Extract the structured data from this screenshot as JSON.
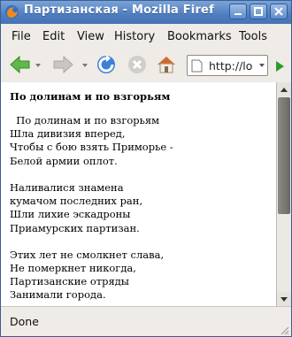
{
  "window": {
    "title": "Партизанская - Mozilla Firef"
  },
  "menu": [
    {
      "label": "File"
    },
    {
      "label": "Edit"
    },
    {
      "label": "View"
    },
    {
      "label": "History"
    },
    {
      "label": "Bookmarks"
    },
    {
      "label": "Tools"
    }
  ],
  "navbar": {
    "url": "http://lo"
  },
  "page": {
    "title": "По долинам и по взгорьям",
    "stanzas": [
      [
        "  По долинам и по взгорьям",
        "Шла дивизия вперед,",
        "Чтобы с бою взять Приморье -",
        "Белой армии оплот."
      ],
      [
        "Наливалися знамена",
        "кумачом последних ран,",
        "Шли лихие эскадроны",
        "Приамурских партизан."
      ],
      [
        "Этих лет не смолкнет слава,",
        "Не померкнет никогда,",
        "Партизанские отряды",
        "Занимали города."
      ]
    ]
  },
  "status": {
    "text": "Done"
  },
  "colors": {
    "titlebar": "#4f7dbf",
    "back_arrow": "#4aa33b",
    "reload": "#3b82d6",
    "go": "#2e9a2e"
  },
  "icons": [
    "firefox-icon",
    "minimize-icon",
    "maximize-icon",
    "close-icon",
    "back-arrow-icon",
    "forward-arrow-icon",
    "reload-icon",
    "stop-icon",
    "home-icon",
    "page-icon",
    "go-icon",
    "resize-grip-icon"
  ]
}
